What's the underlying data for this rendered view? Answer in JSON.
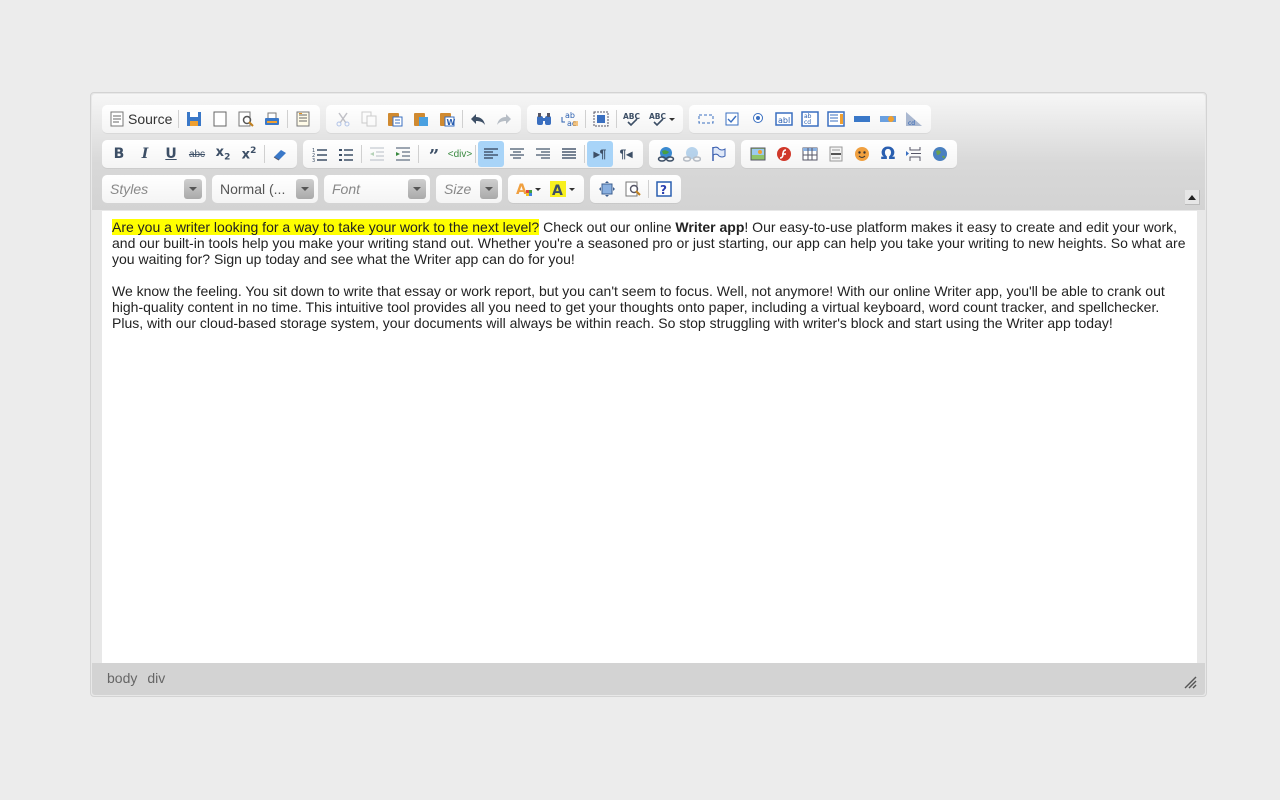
{
  "toolbar": {
    "row1": {
      "document": [
        {
          "name": "source",
          "label": "Source",
          "icon": "source-icon"
        },
        {
          "name": "save",
          "icon": "save-icon"
        },
        {
          "name": "new-page",
          "icon": "new-page-icon"
        },
        {
          "name": "preview",
          "icon": "preview-icon"
        },
        {
          "name": "print",
          "icon": "print-icon"
        },
        {
          "name": "templates",
          "icon": "templates-icon"
        }
      ],
      "clipboard": [
        "cut",
        "copy",
        "paste",
        "paste-text",
        "paste-from-word",
        "undo",
        "redo"
      ],
      "editing": [
        "find",
        "replace",
        "select-all",
        "spellcheck",
        "spellcheck-as-you-type"
      ],
      "forms": [
        "form",
        "checkbox",
        "radio",
        "text-field",
        "textarea",
        "select",
        "button",
        "image-button",
        "hidden-field"
      ]
    },
    "row2": {
      "basicstyles": [
        "bold",
        "italic",
        "underline",
        "strike",
        "subscript",
        "superscript",
        "remove-format"
      ],
      "paragraph": [
        "numbered-list",
        "bulleted-list",
        "outdent",
        "indent",
        "blockquote",
        "create-div",
        "align-left",
        "align-center",
        "align-right",
        "justify",
        "text-direction-ltr",
        "text-direction-rtl"
      ],
      "active": [
        "align-left",
        "text-direction-ltr"
      ],
      "links": [
        "link",
        "unlink",
        "anchor"
      ],
      "insert": [
        "image",
        "flash",
        "table",
        "horizontal-line",
        "smiley",
        "special-char",
        "page-break",
        "iframe"
      ]
    },
    "row3": {
      "styles": {
        "placeholder": "Styles"
      },
      "format": {
        "value": "Normal (..."
      },
      "font": {
        "placeholder": "Font"
      },
      "size": {
        "placeholder": "Size"
      },
      "colors": [
        "text-color",
        "background-color"
      ],
      "tools": [
        "maximize",
        "show-blocks",
        "about"
      ]
    }
  },
  "content": {
    "p1": {
      "highlight": "Are you a writer looking for a way to take your work to the next level?",
      "pre_bold": " Check out our online ",
      "bold": "Writer app",
      "rest": "! Our easy-to-use platform makes it easy to create and edit your work, and our built-in tools help you make your writing stand out. Whether you're a seasoned pro or just starting, our app can help you take your writing to new heights. So what are you waiting for? Sign up today and see what the Writer app can do for you!"
    },
    "p2": "We know the feeling. You sit down to write that essay or work report, but you can't seem to focus. Well, not anymore! With our online Writer app, you'll be able to crank out high-quality content in no time. This intuitive tool provides all you need to get your thoughts onto paper, including a virtual keyboard, word count tracker, and spellchecker. Plus, with our cloud-based storage system, your documents will always be within reach. So stop struggling with writer's block and start using the Writer app today!"
  },
  "elementspath": [
    "body",
    "div"
  ],
  "colors": {
    "highlight": "#ffff00",
    "active_button": "#a8d4f8",
    "accent_blue": "#2f6fb8"
  }
}
